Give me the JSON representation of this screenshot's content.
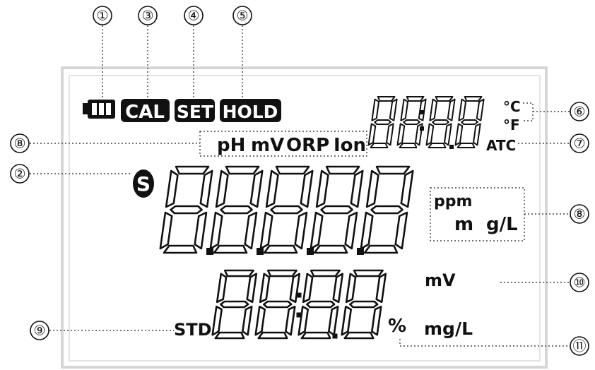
{
  "badges": {
    "cal": "CAL",
    "set": "SET",
    "hold": "HOLD"
  },
  "mode_labels": {
    "ph": "pH",
    "mv": "mV",
    "orp": "ORP",
    "ion": "Ion"
  },
  "temp_units": {
    "celsius": "°C",
    "fahrenheit": "°F",
    "atc": "ATC"
  },
  "stability_indicator": "S",
  "units_main": {
    "ppm": "ppm",
    "m": "m",
    "gl": "g/L"
  },
  "units_secondary": {
    "mv": "mV",
    "mgl": "mg/L",
    "percent": "%",
    "std": "STD"
  },
  "callouts": [
    "①",
    "②",
    "③",
    "④",
    "⑤",
    "⑥",
    "⑦",
    "⑧",
    "⑧",
    "⑨",
    "⑩",
    "⑪"
  ]
}
